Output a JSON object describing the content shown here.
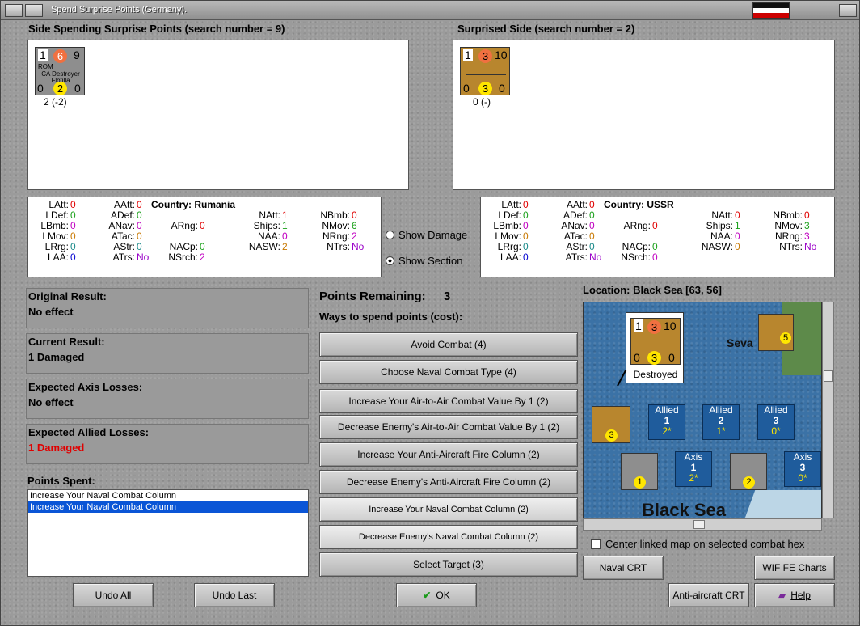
{
  "window": {
    "title": "Spend Surprise Points (Germany)."
  },
  "left_side": {
    "header": "Side Spending Surprise Points (search number = 9)",
    "counter": {
      "nation": "ROM",
      "unit": "CA Destroyer Flotilla",
      "top_left": "1",
      "top_mid": "6",
      "top_right": "9",
      "bot_left": "0",
      "bot_mid": "2",
      "bot_right": "0",
      "caption": "2 (-2)"
    }
  },
  "right_side": {
    "header": "Surprised Side (search number = 2)",
    "counter": {
      "top_left": "1",
      "top_mid": "3",
      "top_right": "10",
      "bot_left": "0",
      "bot_mid": "3",
      "bot_right": "0",
      "caption": "0 (-)"
    }
  },
  "stats_left": {
    "country_label": "Country:",
    "country": "Rumania",
    "c1": [
      [
        "LAtt:",
        "0"
      ],
      [
        "LDef:",
        "0"
      ],
      [
        "LBmb:",
        "0"
      ],
      [
        "LMov:",
        "0"
      ],
      [
        "LRrg:",
        "0"
      ],
      [
        "LAA:",
        "0"
      ]
    ],
    "c2": [
      [
        "AAtt:",
        "0"
      ],
      [
        "ADef:",
        "0"
      ],
      [
        "ANav:",
        "0"
      ],
      [
        "ATac:",
        "0"
      ],
      [
        "AStr:",
        "0"
      ],
      [
        "ATrs:",
        "No"
      ]
    ],
    "c3": [
      [
        "ARng:",
        "0"
      ],
      [
        "NACp:",
        "0"
      ],
      [
        "NSrch:",
        "2"
      ]
    ],
    "c4": [
      [
        "NAtt:",
        "1"
      ],
      [
        "Ships:",
        "1"
      ],
      [
        "NAA:",
        "0"
      ],
      [
        "NASW:",
        "2"
      ]
    ],
    "c5": [
      [
        "NBmb:",
        "0"
      ],
      [
        "NMov:",
        "6"
      ],
      [
        "NRng:",
        "2"
      ],
      [
        "NTrs:",
        "No"
      ]
    ]
  },
  "stats_right": {
    "country_label": "Country:",
    "country": "USSR",
    "c1": [
      [
        "LAtt:",
        "0"
      ],
      [
        "LDef:",
        "0"
      ],
      [
        "LBmb:",
        "0"
      ],
      [
        "LMov:",
        "0"
      ],
      [
        "LRrg:",
        "0"
      ],
      [
        "LAA:",
        "0"
      ]
    ],
    "c2": [
      [
        "AAtt:",
        "0"
      ],
      [
        "ADef:",
        "0"
      ],
      [
        "ANav:",
        "0"
      ],
      [
        "ATac:",
        "0"
      ],
      [
        "AStr:",
        "0"
      ],
      [
        "ATrs:",
        "No"
      ]
    ],
    "c3": [
      [
        "ARng:",
        "0"
      ],
      [
        "NACp:",
        "0"
      ],
      [
        "NSrch:",
        "0"
      ]
    ],
    "c4": [
      [
        "NAtt:",
        "0"
      ],
      [
        "Ships:",
        "1"
      ],
      [
        "NAA:",
        "0"
      ],
      [
        "NASW:",
        "0"
      ]
    ],
    "c5": [
      [
        "NBmb:",
        "0"
      ],
      [
        "NMov:",
        "3"
      ],
      [
        "NRng:",
        "3"
      ],
      [
        "NTrs:",
        "No"
      ]
    ]
  },
  "options": {
    "show_damage": "Show Damage",
    "show_section": "Show Section"
  },
  "results": {
    "original_label": "Original Result:",
    "original": "No effect",
    "current_label": "Current Result:",
    "current": "1 Damaged",
    "axis_label": "Expected Axis Losses:",
    "axis": "No effect",
    "allied_label": "Expected Allied Losses:",
    "allied": "1 Damaged"
  },
  "points_spent": {
    "label": "Points Spent:",
    "items": [
      "Increase Your Naval Combat Column",
      "Increase Your Naval Combat Column"
    ]
  },
  "spend": {
    "remaining_label": "Points Remaining:",
    "remaining": "3",
    "ways_label": "Ways to spend points (cost):",
    "buttons": [
      "Avoid Combat (4)",
      "Choose Naval Combat Type (4)",
      "Increase Your Air-to-Air Combat Value By 1 (2)",
      "Decrease Enemy's Air-to-Air Combat Value By 1 (2)",
      "Increase Your Anti-Aircraft Fire Column (2)",
      "Decrease Enemy's Anti-Aircraft Fire Column (2)",
      "Increase Your Naval Combat Column (2)",
      "Decrease Enemy's Naval Combat Column (2)",
      "Select Target (3)"
    ]
  },
  "map": {
    "location": "Location: Black Sea [63, 56]",
    "destroyed": "Destroyed",
    "sea_label": "Black Sea",
    "city": "Seva",
    "allied_boxes": [
      {
        "side": "Allied",
        "num": "1",
        "val": "2*"
      },
      {
        "side": "Allied",
        "num": "2",
        "val": "1*"
      },
      {
        "side": "Allied",
        "num": "3",
        "val": "0*"
      }
    ],
    "axis_boxes": [
      {
        "side": "Axis",
        "num": "1",
        "val": "2*"
      },
      {
        "side": "Axis",
        "num": "3",
        "val": "0*"
      }
    ],
    "center_check": "Center linked map on selected combat hex"
  },
  "bottom": {
    "undo_all": "Undo All",
    "undo_last": "Undo Last",
    "ok": "OK",
    "naval_crt": "Naval CRT",
    "wif_charts": "WIF FE Charts",
    "aa_crt": "Anti-aircraft CRT",
    "help": "Help"
  },
  "colors": {
    "naval_counter": "#b8862e",
    "rom_counter": "#8e8e8e",
    "selection": "#0a55d6",
    "red": "#e00000"
  }
}
